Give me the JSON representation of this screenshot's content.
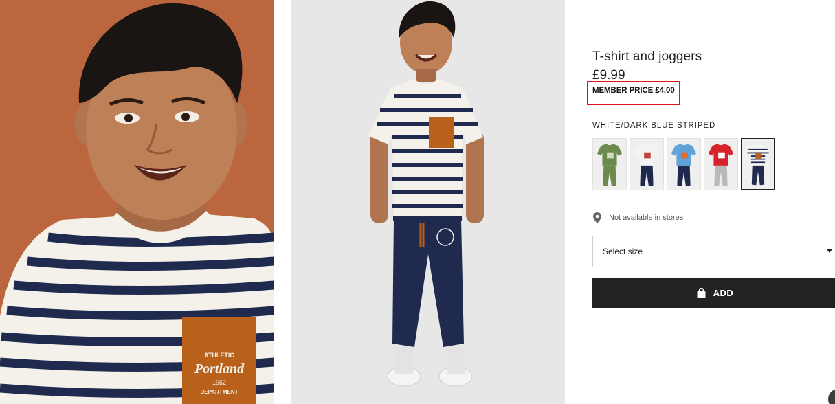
{
  "product": {
    "title": "T-shirt and joggers",
    "price": "£9.99",
    "member_price": "MEMBER PRICE £4.00",
    "color_name": "WHITE/DARK BLUE STRIPED"
  },
  "images": {
    "left_pocket_text_top": "ATHLETIC",
    "left_pocket_text_main": "Portland",
    "left_pocket_text_year": "1952",
    "left_pocket_text_bottom": "DEPARTMENT"
  },
  "swatches": [
    {
      "name": "green-dinosaur-set",
      "shirt": "#6b8a4e",
      "pants": "#6b8a4e",
      "print": "#cfd9c4"
    },
    {
      "name": "white-print-set",
      "shirt": "#f4f4f4",
      "pants": "#1f2a4e",
      "print": "#c4433c"
    },
    {
      "name": "blue-shark-set",
      "shirt": "#5fa3d8",
      "pants": "#1f2a4e",
      "print": "#e26b2e"
    },
    {
      "name": "new-york-set",
      "shirt": "#d8222b",
      "pants": "#b9b9b9",
      "print": "#ffffff"
    },
    {
      "name": "white-dark-blue-striped-set",
      "shirt": "#f4f4f4",
      "pants": "#1f2a4e",
      "print": "#b9611b",
      "selected": true
    }
  ],
  "availability": {
    "icon": "location-pin-icon",
    "text": "Not available in stores"
  },
  "size_select": {
    "label": "Select size",
    "icon": "chevron-down-icon"
  },
  "add_button": {
    "label": "ADD",
    "icon": "shopping-bag-icon"
  },
  "colors": {
    "highlight": "#e0141e",
    "button": "#222222",
    "brand_text": "#222222"
  }
}
